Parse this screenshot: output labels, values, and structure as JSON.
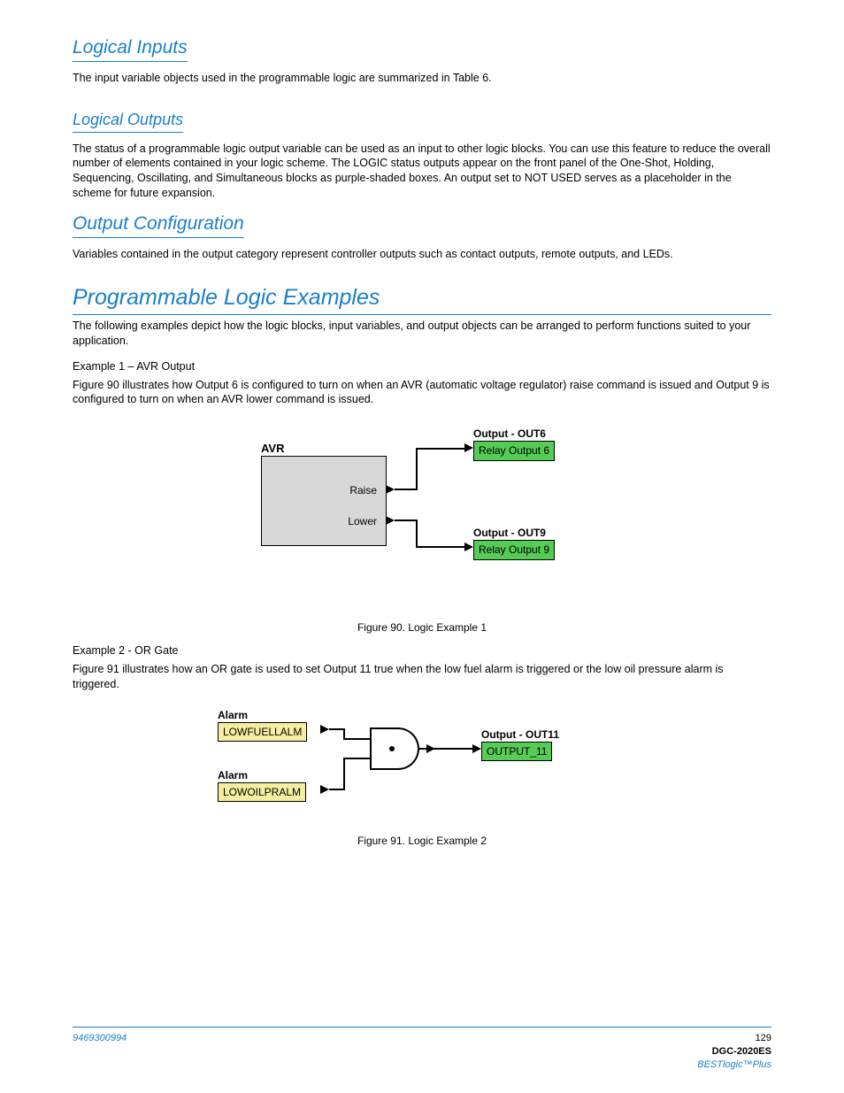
{
  "sections": {
    "s1": {
      "title": "Logical Inputs",
      "body": "The input variable objects used in the programmable logic are summarized in Table 6."
    },
    "s2": {
      "title": "Logical Outputs",
      "body": "The status of a programmable logic output variable can be used as an input to other logic blocks. You can use this feature to reduce the overall number of elements contained in your logic scheme. The LOGIC status outputs appear on the front panel of the One-Shot, Holding, Sequencing, Oscillating, and Simultaneous blocks as purple-shaded boxes. An output set to NOT USED serves as a placeholder in the scheme for future expansion."
    },
    "s3": {
      "title": "Output Configuration",
      "body": "Variables contained in the output category represent controller outputs such as contact outputs, remote outputs, and LEDs."
    }
  },
  "examples": {
    "title": "Programmable Logic Examples",
    "intro": "The following examples depict how the logic blocks, input variables, and output objects can be arranged to perform functions suited to your application.",
    "ex1": {
      "title": "Example 1 – AVR Output",
      "lead": "Figure 90 illustrates how Output 6 is configured to turn on when an AVR (automatic voltage regulator) raise command is issued and Output 9 is configured to turn on when an AVR lower command is issued."
    },
    "ex2": {
      "title": "Example 2 - OR Gate",
      "lead": "Figure 91 illustrates how an OR gate is used to set Output 11 true when the low fuel alarm is triggered or the low oil pressure alarm is triggered."
    }
  },
  "fig1": {
    "avr_label": "AVR",
    "port_raise": "Raise",
    "port_lower": "Lower",
    "out6_label": "Output - OUT6",
    "out6_box": "Relay Output 6",
    "out9_label": "Output - OUT9",
    "out9_box": "Relay Output 9",
    "caption": "Figure 90. Logic Example 1"
  },
  "fig2": {
    "alarm1_label": "Alarm",
    "alarm1_box": "LOWFUELLALM",
    "alarm2_label": "Alarm",
    "alarm2_box": "LOWOILPRALM",
    "out_label": "Output - OUT11",
    "out_box": "OUTPUT_11",
    "caption": "Figure 91. Logic Example 2"
  },
  "footer": {
    "left": "9469300994",
    "right_line1": "129",
    "right_title": "DGC-2020ES",
    "right_sub": "BESTlogic™Plus"
  }
}
